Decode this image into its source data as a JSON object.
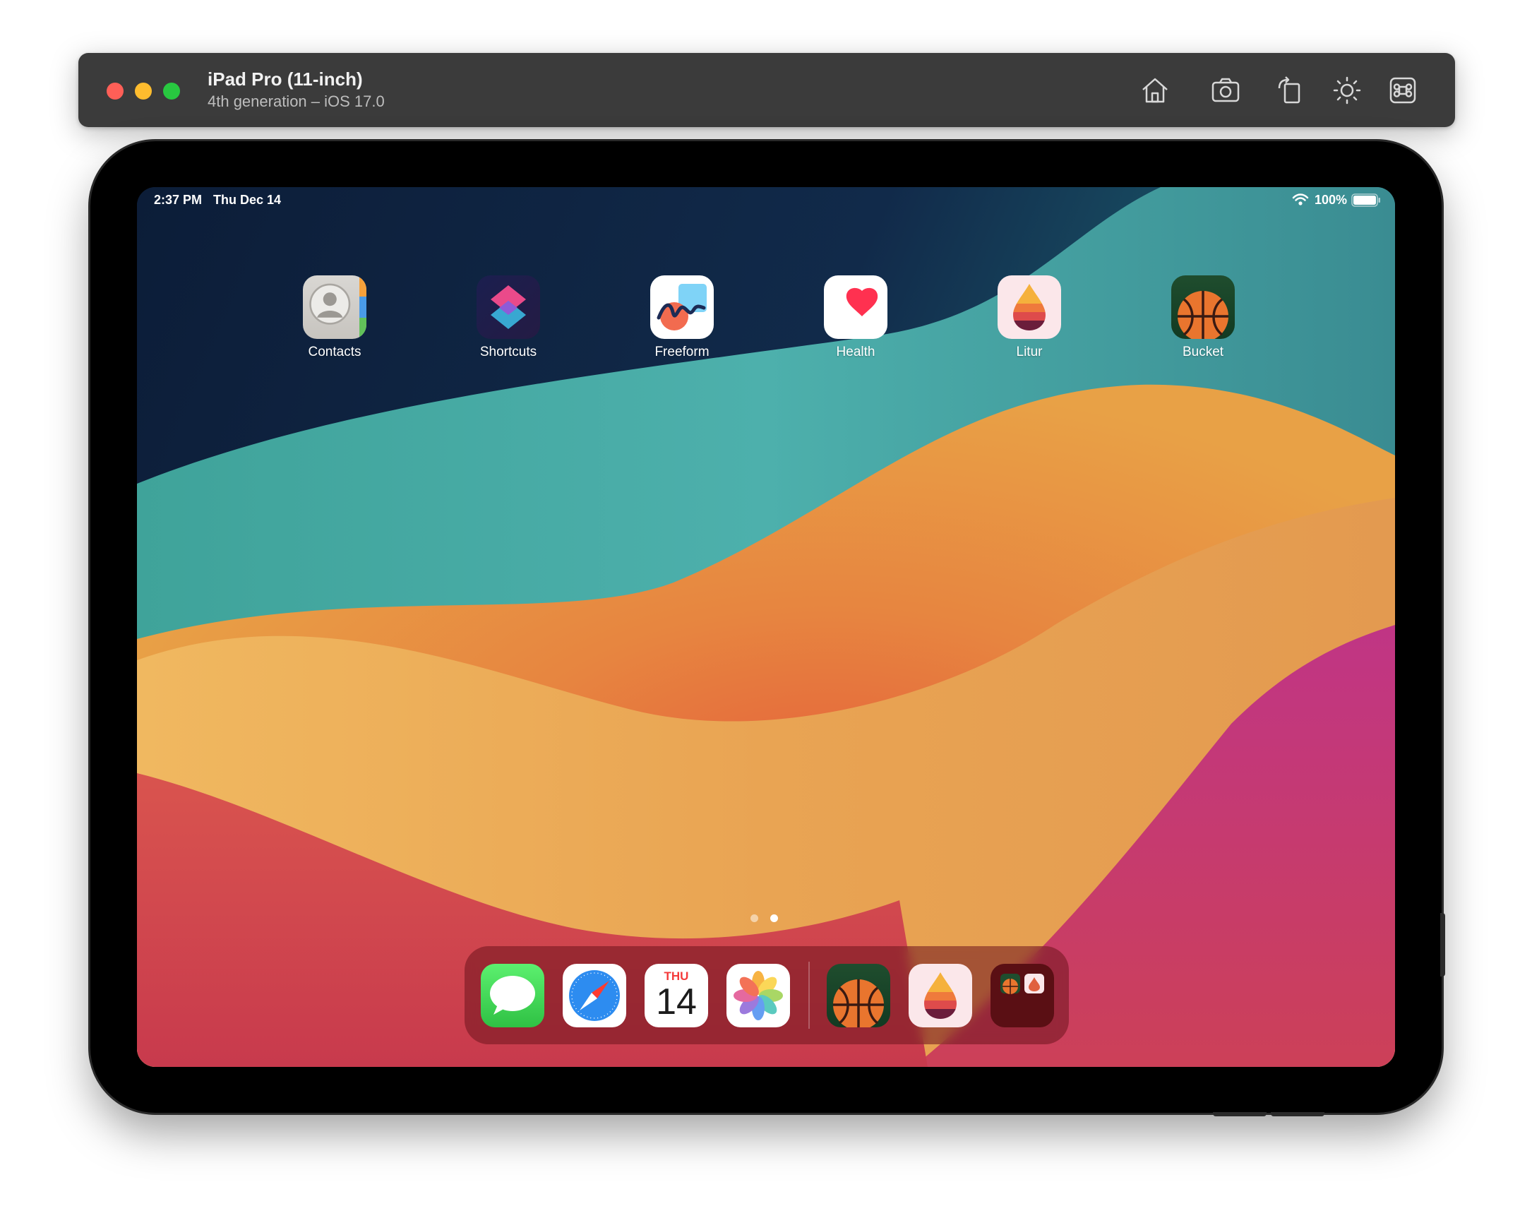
{
  "window": {
    "title": "iPad Pro (11-inch)",
    "subtitle": "4th generation – iOS 17.0",
    "toolbar": [
      "home-icon",
      "screenshot-icon",
      "rotate-icon",
      "appearance-icon",
      "command-icon"
    ]
  },
  "status_bar": {
    "time": "2:37 PM",
    "date": "Thu Dec 14",
    "battery": "100%"
  },
  "home_apps": [
    {
      "name": "Contacts"
    },
    {
      "name": "Shortcuts"
    },
    {
      "name": "Freeform"
    },
    {
      "name": "Health"
    },
    {
      "name": "Litur"
    },
    {
      "name": "Bucket"
    }
  ],
  "page_indicator": {
    "pages": 2,
    "current": 2
  },
  "dock": {
    "apps": [
      "Messages",
      "Safari",
      "Calendar",
      "Photos"
    ],
    "recent": [
      "Bucket",
      "Litur",
      "App Library folder"
    ],
    "calendar": {
      "weekday": "THU",
      "day": "14"
    }
  },
  "colors": {
    "wallpaper_top": "#0f2340",
    "wallpaper_teal": "#4fb3a6",
    "wallpaper_orange": "#e8913a",
    "wallpaper_magenta": "#c7337f",
    "wallpaper_red": "#d24456"
  }
}
